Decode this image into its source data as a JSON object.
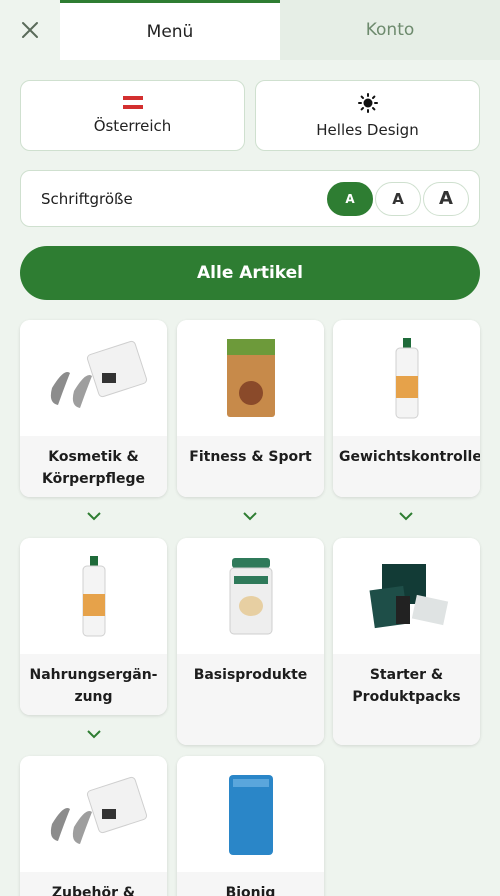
{
  "tabs": {
    "menu": "Menü",
    "konto": "Konto"
  },
  "settings": {
    "country": "Österreich",
    "theme": "Helles Design",
    "font_size_label": "Schriftgröße",
    "font_sizes": [
      "A",
      "A",
      "A"
    ]
  },
  "all_articles": "Alle Artikel",
  "categories": [
    {
      "label": "Kosmetik & Körperpflege"
    },
    {
      "label": "Fitness & Sport"
    },
    {
      "label": "Gewichtskontrolle"
    },
    {
      "label": "Nahrungsergän-zung"
    },
    {
      "label": "Basisprodukte"
    },
    {
      "label": "Starter & Produktpacks"
    },
    {
      "label": "Zubehör &"
    },
    {
      "label": "Bioniq"
    }
  ],
  "colors": {
    "accent": "#2e7d32",
    "background": "#eef4ee"
  }
}
